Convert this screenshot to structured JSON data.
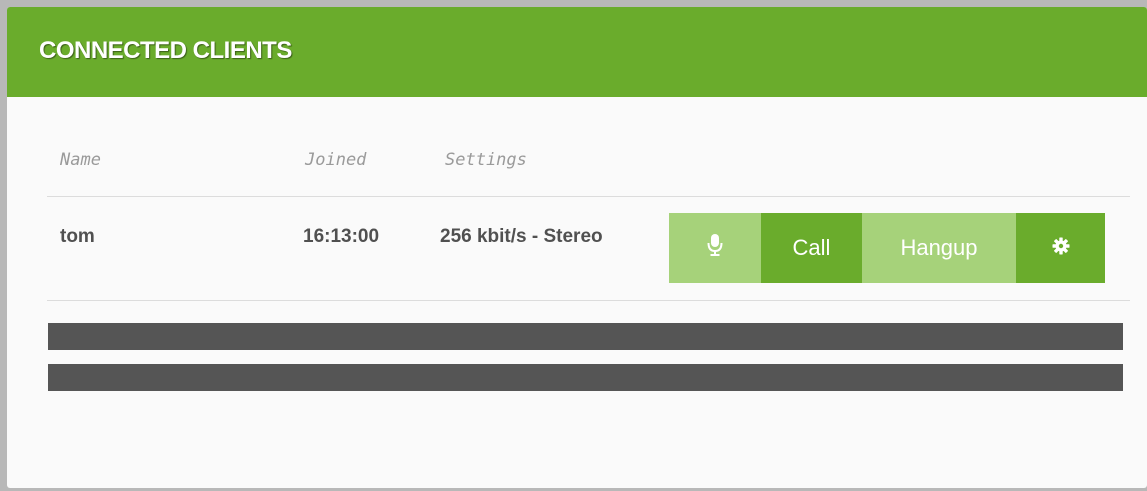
{
  "panel": {
    "title": "CONNECTED CLIENTS"
  },
  "table": {
    "headers": [
      "Name",
      "Joined",
      "Settings"
    ],
    "rows": [
      {
        "name": "tom",
        "joined": "16:13:00",
        "settings": "256 kbit/s - Stereo",
        "actions": {
          "mic_icon": "microphone-icon",
          "call_label": "Call",
          "hangup_label": "Hangup",
          "settings_icon": "gear-icon"
        }
      }
    ]
  },
  "colors": {
    "accent": "#6aac2c",
    "accent_light": "#a6d27a",
    "bar": "#555555"
  },
  "meters": [
    {
      "name": "level-meter-1",
      "fill": 1.0
    },
    {
      "name": "level-meter-2",
      "fill": 1.0
    }
  ]
}
